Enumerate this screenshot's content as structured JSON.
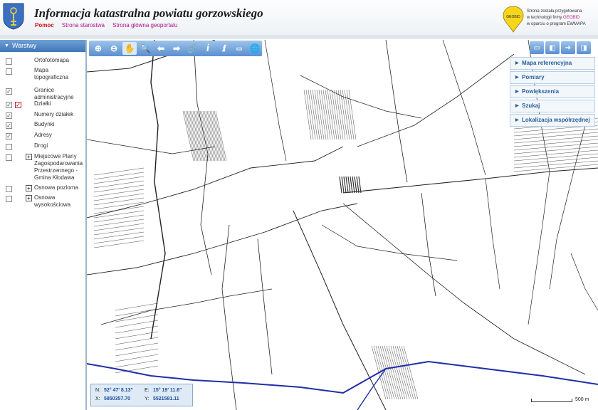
{
  "header": {
    "title": "Informacja katastralna powiatu gorzowskiego",
    "links": [
      "Pomoc",
      "Strona starostwa",
      "Strona główna geoportalu"
    ],
    "vendor_lines": [
      "Strona została przygotowana",
      "w technologii firmy",
      "GEOBID",
      "w oparciu o program EWMAPA"
    ],
    "vendor_logo_text": "GEOBID"
  },
  "sidebar": {
    "panel_title": "Warstwy",
    "layers": [
      {
        "label": "Ortofotomapa",
        "checked": false,
        "expandable": false
      },
      {
        "label": "Mapa topograficzna",
        "checked": false,
        "expandable": false
      },
      {
        "label": "Granice administracyjne",
        "checked": true,
        "expandable": false
      },
      {
        "label": "Działki",
        "checked": true,
        "expandable": false,
        "extra_checked": true
      },
      {
        "label": "Numery działek",
        "checked": true,
        "expandable": false
      },
      {
        "label": "Budynki",
        "checked": true,
        "expandable": false
      },
      {
        "label": "Adresy",
        "checked": true,
        "expandable": false
      },
      {
        "label": "Drogi",
        "checked": false,
        "expandable": false
      },
      {
        "label": "Miejscowe Plany Zagospodarowania Przestrzennego - Gmina Kłodawa",
        "checked": false,
        "expandable": true
      },
      {
        "label": "Osnowa pozioma",
        "checked": false,
        "expandable": true
      },
      {
        "label": "Osnowa wysokościowa",
        "checked": false,
        "expandable": true
      }
    ]
  },
  "toolbar": {
    "tools": [
      "zoom-in-icon",
      "zoom-out-icon",
      "pan-hand-icon",
      "zoom-box-icon",
      "back-arrow-icon",
      "forward-arrow-icon",
      "link-icon",
      "info-icon",
      "query-info-icon",
      "measure-icon",
      "globe-icon"
    ],
    "active_tool": "pan-hand-icon"
  },
  "right_tools": [
    "layout-full-icon",
    "layout-left-icon",
    "export-icon",
    "panel-toggle-icon"
  ],
  "menu": {
    "items": [
      "Mapa referencyjna",
      "Pomiary",
      "Powiększenia",
      "Szukaj",
      "Lokalizacja współrzędnej"
    ]
  },
  "coords": {
    "n_label": "N:",
    "n_value": "52° 47' 8.13\"",
    "e_label": "E:",
    "e_value": "15° 19' 11.6\"",
    "x_label": "X:",
    "x_value": "5850357.70",
    "y_label": "Y:",
    "y_value": "5521581.11"
  },
  "scale": {
    "label": "500 m"
  },
  "colors": {
    "accent": "#4d86c6",
    "link_primary": "#d10d0d",
    "link_secondary": "#b0108c",
    "boundary": "#1f2fa8",
    "parcel_lines": "#222222"
  }
}
